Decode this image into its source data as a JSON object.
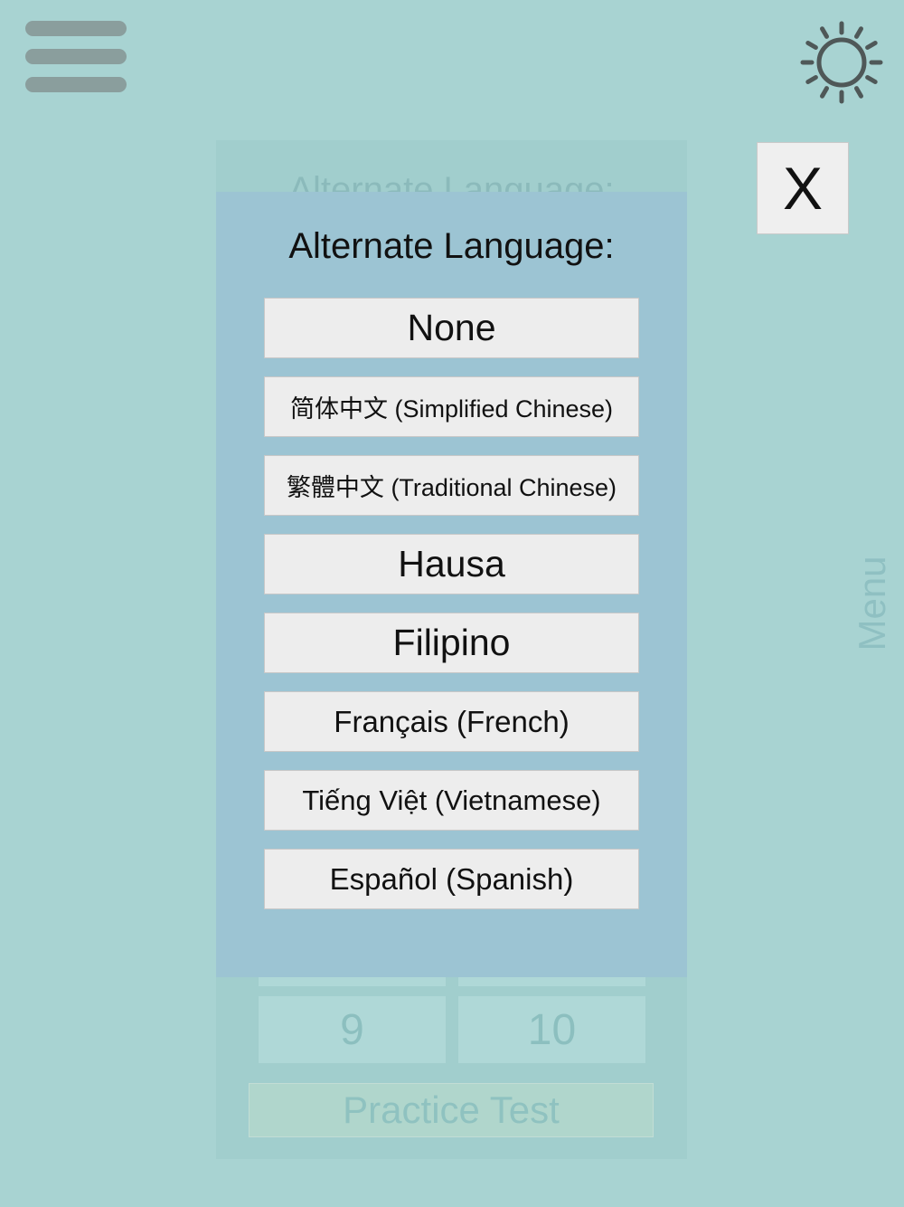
{
  "header": {
    "menu_icon": "hamburger-menu-icon",
    "theme_icon": "sun-icon"
  },
  "close_button": {
    "label": "X"
  },
  "side_menu": {
    "label": "Menu"
  },
  "background": {
    "title": "Alternate Language:",
    "grid": [
      "9",
      "10"
    ],
    "practice_button": "Practice Test"
  },
  "dialog": {
    "title": "Alternate Language:",
    "options": [
      {
        "label": "None"
      },
      {
        "label": "简体中文 (Simplified Chinese)"
      },
      {
        "label": "繁體中文 (Traditional Chinese)"
      },
      {
        "label": "Hausa"
      },
      {
        "label": "Filipino"
      },
      {
        "label": "Français (French)"
      },
      {
        "label": "Tiếng Việt (Vietnamese)"
      },
      {
        "label": "Español (Spanish)"
      }
    ]
  },
  "colors": {
    "background": "#a8d3d2",
    "dialog": "#9cc4d3",
    "button": "#ededed"
  }
}
